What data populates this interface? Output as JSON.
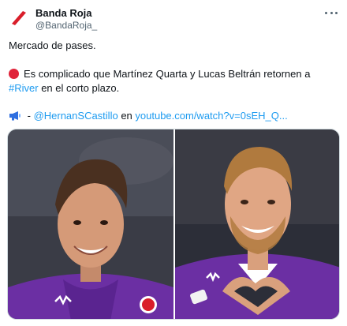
{
  "author": {
    "name": "Banda Roja",
    "handle": "@BandaRoja_",
    "avatar_icon": "red-slash-logo"
  },
  "more_icon": "more-horizontal-icon",
  "tweet": {
    "line1": "Mercado de pases.",
    "line2_text": "Es complicado que Martínez Quarta y Lucas Beltrán retornen a",
    "line3_hashtag": "#River",
    "line3_rest": " en el corto plazo.",
    "line4_prefix": " - ",
    "line4_mention": "@HernanSCastillo",
    "line4_middle": " en ",
    "line4_url": "youtube.com/watch?v=0sEH_Q..."
  },
  "icons": {
    "red_circle": "red-circle-icon",
    "megaphone": "megaphone-icon"
  },
  "colors": {
    "link": "#1d9bf0",
    "purple_kit": "#5a2a8c",
    "red_accent": "#e0243a"
  },
  "media": {
    "photos": [
      "photo-player-left",
      "photo-player-right"
    ]
  }
}
